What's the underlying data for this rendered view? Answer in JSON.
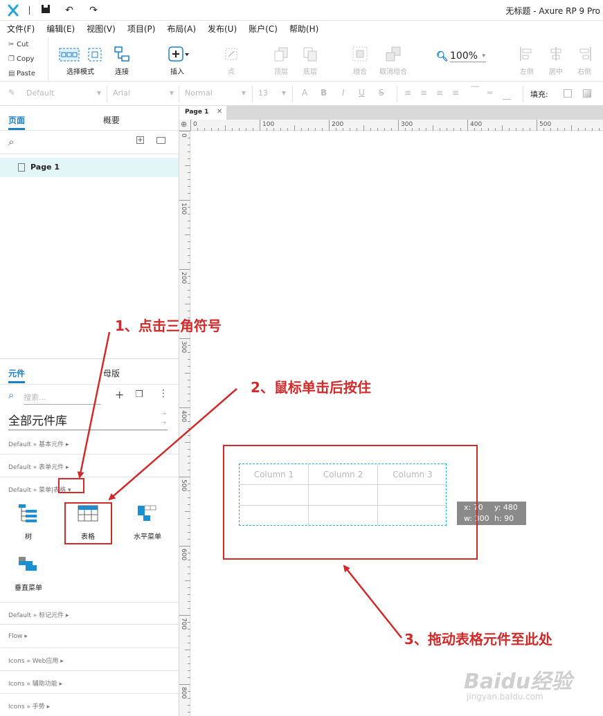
{
  "window": {
    "title": "无标题 - Axure RP 9 Pro"
  },
  "menu": [
    "文件(F)",
    "编辑(E)",
    "视图(V)",
    "项目(P)",
    "布局(A)",
    "发布(U)",
    "账户(C)",
    "帮助(H)"
  ],
  "clipboard": {
    "cut": "Cut",
    "copy": "Copy",
    "paste": "Paste"
  },
  "toolbar": {
    "select_mode": "选择模式",
    "connect": "连接",
    "insert": "插入",
    "point": "点",
    "top": "顶层",
    "bottom": "底层",
    "group": "组合",
    "ungroup": "取消组合",
    "left": "左侧",
    "center": "居中",
    "right": "右侧",
    "zoom": "100%"
  },
  "format": {
    "style": "Default",
    "font": "Arial",
    "weight": "Normal",
    "size": "13",
    "fill_label": "填充:",
    "bold": "B",
    "italic": "I",
    "underline": "U",
    "font_color": "A"
  },
  "pages_panel": {
    "tab_pages": "页面",
    "tab_outline": "概要",
    "pages": [
      "Page 1"
    ]
  },
  "widgets_panel": {
    "tab_widgets": "元件",
    "tab_masters": "母版",
    "search_placeholder": "搜索...",
    "library": "全部元件库",
    "categories": {
      "basic": "Default » 基本元件 ▸",
      "form": "Default » 表单元件 ▸",
      "menu_table": "Default » 菜单|表格 ▾",
      "markup": "Default » 标记元件 ▸",
      "flow": "Flow ▸",
      "icons_web": "Icons » Web应用 ▸",
      "icons_access": "Icons » 辅助功能 ▸",
      "icons_hand": "Icons » 手势 ▸"
    },
    "widgets": {
      "tree": "树",
      "table": "表格",
      "hmenu": "水平菜单",
      "vmenu": "垂直菜单"
    }
  },
  "canvas": {
    "tab": "Page 1",
    "ruler_h": [
      "0",
      "100",
      "200",
      "300",
      "400",
      "500"
    ],
    "ruler_v": [
      "0",
      "100",
      "200",
      "300",
      "400",
      "500",
      "600",
      "700",
      "800"
    ],
    "table_headers": [
      "Column 1",
      "Column 2",
      "Column 3"
    ],
    "tooltip": {
      "x": "x: 70",
      "y": "y: 480",
      "w": "w: 300",
      "h": "h: 90"
    }
  },
  "annotations": {
    "step1": "1、点击三角符号",
    "step2": "2、鼠标单击后按住",
    "step3": "3、拖动表格元件至此处"
  },
  "watermark": {
    "line1": "Baidu经验",
    "line2": "jingyan.baidu.com"
  },
  "colors": {
    "accent": "#1b7fc6",
    "annotation": "#d12a2a",
    "selection": "#1db3c4",
    "page_highlight": "#e2f6f8"
  }
}
